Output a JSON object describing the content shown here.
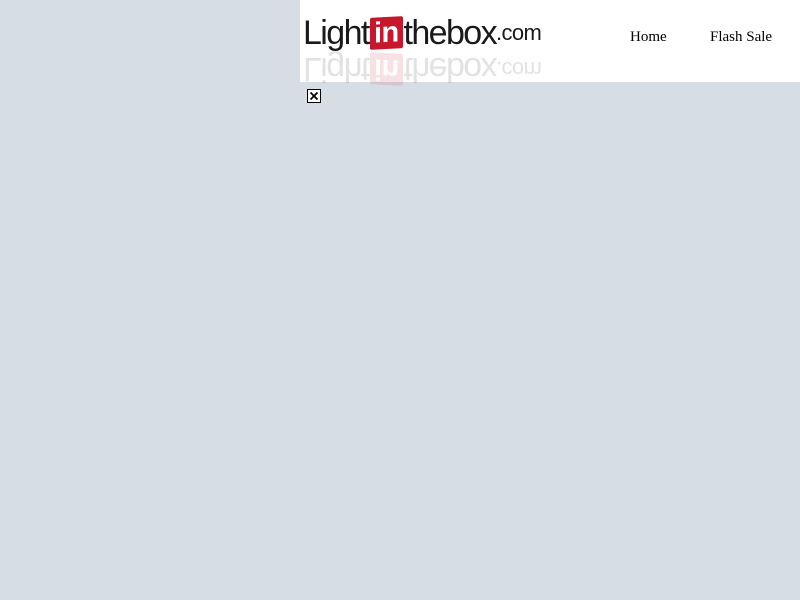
{
  "header": {
    "logo": {
      "part1": "Light",
      "part2": "in",
      "part3": "thebox",
      "part4": ".com",
      "alt": "Lightinthebox.com",
      "accent_color": "#c8162d"
    },
    "nav": {
      "home_label": "Home",
      "flash_sale_label": "Flash Sale"
    }
  },
  "close_button": {
    "icon": "close-icon"
  },
  "colors": {
    "page_background": "#d7dde4",
    "header_background": "#ffffff"
  }
}
